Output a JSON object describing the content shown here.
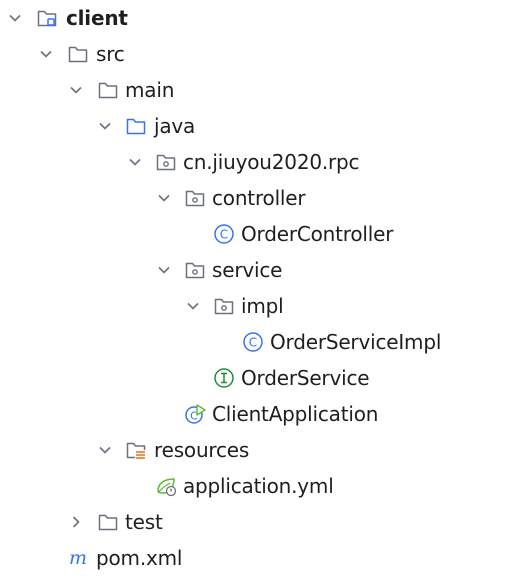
{
  "project_tree": {
    "items": [
      {
        "label": "client",
        "icon": "module-folder-icon",
        "expanded": true
      },
      {
        "label": "src",
        "icon": "folder-icon",
        "expanded": true
      },
      {
        "label": "main",
        "icon": "folder-icon",
        "expanded": true
      },
      {
        "label": "java",
        "icon": "source-root-folder-icon",
        "expanded": true
      },
      {
        "label": "cn.jiuyou2020.rpc",
        "icon": "package-icon",
        "expanded": true
      },
      {
        "label": "controller",
        "icon": "package-icon",
        "expanded": true
      },
      {
        "label": "OrderController",
        "icon": "class-icon"
      },
      {
        "label": "service",
        "icon": "package-icon",
        "expanded": true
      },
      {
        "label": "impl",
        "icon": "package-icon",
        "expanded": true
      },
      {
        "label": "OrderServiceImpl",
        "icon": "class-icon"
      },
      {
        "label": "OrderService",
        "icon": "interface-icon"
      },
      {
        "label": "ClientApplication",
        "icon": "spring-boot-app-icon"
      },
      {
        "label": "resources",
        "icon": "resources-folder-icon",
        "expanded": true
      },
      {
        "label": "application.yml",
        "icon": "spring-yml-icon"
      },
      {
        "label": "test",
        "icon": "folder-icon",
        "expanded": false
      },
      {
        "label": "pom.xml",
        "icon": "maven-icon"
      }
    ]
  },
  "colors": {
    "folder_stroke": "#6c707e",
    "source_root_blue": "#3574f0",
    "class_blue": "#3574f0",
    "interface_green": "#208a3c",
    "spring_green": "#5fb832",
    "resources_orange": "#e66d17",
    "text": "#1f1f1f"
  }
}
